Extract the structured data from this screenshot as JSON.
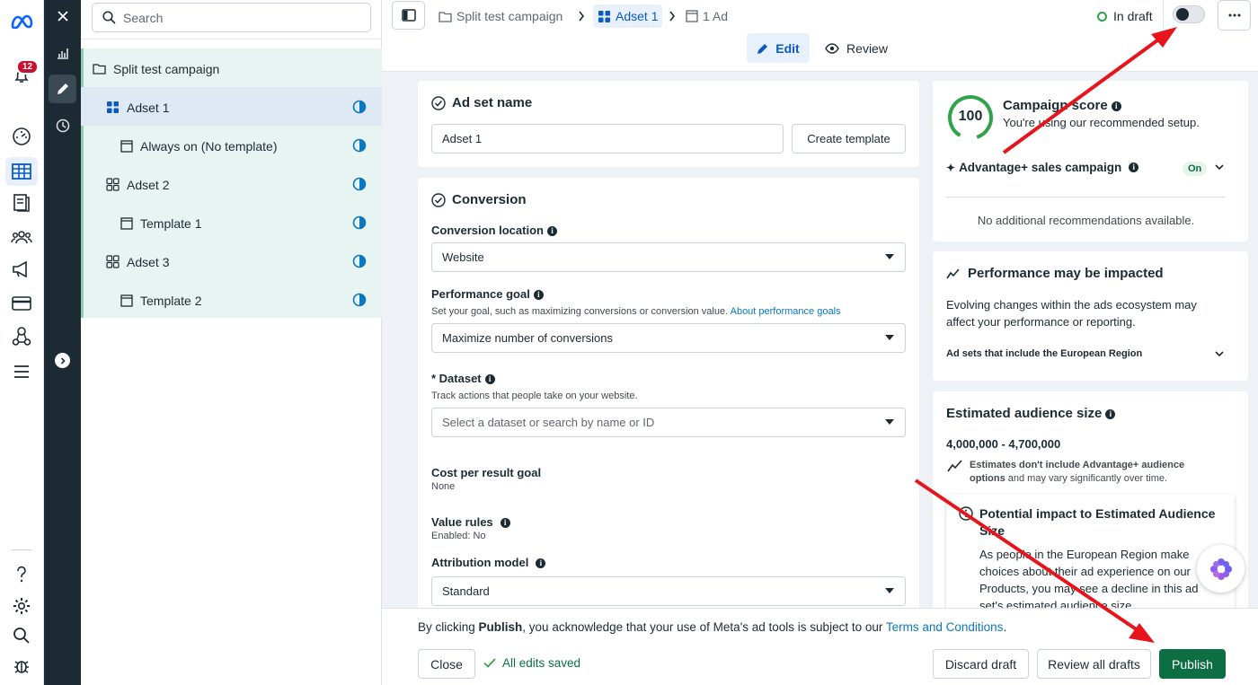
{
  "rail": {
    "notification_count": "12"
  },
  "tree": {
    "search_placeholder": "Search",
    "items": [
      {
        "label": "Split test campaign"
      },
      {
        "label": "Adset 1"
      },
      {
        "label": "Always on (No template)"
      },
      {
        "label": "Adset 2"
      },
      {
        "label": "Template 1"
      },
      {
        "label": "Adset 3"
      },
      {
        "label": "Template 2"
      }
    ]
  },
  "topbar": {
    "breadcrumbs": [
      "Split test campaign",
      "Adset 1",
      "1 Ad"
    ],
    "status": "In draft",
    "tabs": {
      "edit": "Edit",
      "review": "Review"
    }
  },
  "adset": {
    "title": "Ad set name",
    "name_value": "Adset 1",
    "create_template": "Create template"
  },
  "conversion": {
    "title": "Conversion",
    "location_label": "Conversion location",
    "location_value": "Website",
    "goal_label": "Performance goal",
    "goal_help": "Set your goal, such as maximizing conversions or conversion value.",
    "goal_link": "About performance goals",
    "goal_value": "Maximize number of conversions",
    "dataset_label": "* Dataset",
    "dataset_help": "Track actions that people take on your website.",
    "dataset_placeholder": "Select a dataset or search by name or ID",
    "cost_label": "Cost per result goal",
    "cost_value": "None",
    "value_rules_label": "Value rules",
    "value_rules_value": "Enabled: No",
    "attribution_label": "Attribution model",
    "attribution_value": "Standard"
  },
  "score": {
    "value": "100",
    "title": "Campaign score",
    "subtitle": "You're using our recommended setup.",
    "advantage_label": "Advantage+ sales campaign",
    "advantage_status": "On",
    "no_recs": "No additional recommendations available."
  },
  "performance": {
    "title": "Performance may be impacted",
    "body": "Evolving changes within the ads ecosystem may affect your performance or reporting.",
    "region_label": "Ad sets that include the European Region"
  },
  "audience": {
    "title": "Estimated audience size",
    "range": "4,000,000 - 4,700,000",
    "note_bold": "Estimates don't include Advantage+ audience options",
    "note_rest": " and may vary significantly over time.",
    "impact_title": "Potential impact to Estimated Audience Size",
    "impact_body": "As people in the European Region make choices about their ad experience on our Products, you may see a decline in this ad set's estimated audience size."
  },
  "footer": {
    "notice_pre": "By clicking ",
    "notice_bold": "Publish",
    "notice_mid": ", you acknowledge that your use of Meta's ad tools is subject to our ",
    "notice_link": "Terms and Conditions",
    "notice_end": ".",
    "close": "Close",
    "saved": "All edits saved",
    "discard": "Discard draft",
    "review_all": "Review all drafts",
    "publish": "Publish"
  },
  "colors": {
    "accent": "#0a78be",
    "publish_bg": "#0d6e43",
    "saved_green": "#31a24c",
    "arrow_red": "#e8141b",
    "tree_selected": "#e8f4f1"
  }
}
